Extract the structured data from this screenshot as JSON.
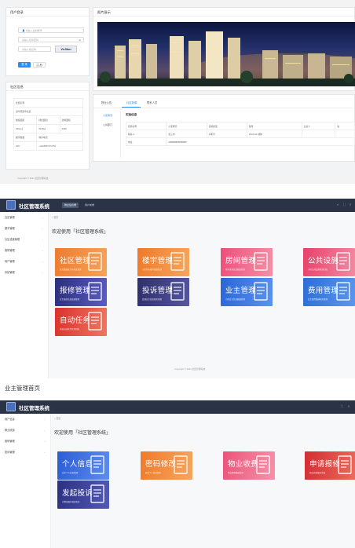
{
  "admin_login": {
    "user_card_title": "用户登录",
    "username_placeholder": "请输入您的账号",
    "password_placeholder": "请输入您的密码",
    "captcha_placeholder": "请输入验证码",
    "captcha_text": "Vn3bm",
    "login_label": "登 录",
    "reset_label": "注 册",
    "banner_title": "图片展示",
    "info_card_title": "社区信息",
    "info_rows": [
      [
        "社区名称",
        ""
      ],
      [
        "锦华苑锦华社区",
        ""
      ],
      [
        "楼栋面积",
        "绿化面积",
        "建筑面积"
      ],
      [
        "2310㎡",
        "5128㎡",
        "3600"
      ],
      [
        "楼宇数量",
        "联系电话"
      ],
      [
        "108",
        "+4415857074751"
      ]
    ],
    "tabs": [
      "物业公告",
      "社区新闻",
      "联系人员"
    ],
    "side_links": [
      "小区概况",
      "公共部门"
    ],
    "detail_title": "实验信息",
    "detail_rows": [
      [
        "实验名称",
        "小区概况",
        "实验类型",
        "院所",
        "负责人",
        "说"
      ],
      [
        "联系人",
        "张三丰",
        "手机号",
        "2024-02-9图8",
        "",
        ""
      ],
      [
        "地址",
        "408888888888888",
        "",
        "",
        "",
        ""
      ]
    ],
    "footer": "Copyright © 2021 社区管理系统"
  },
  "admin_home": {
    "app_title": "社区管理系统",
    "top_tabs": [
      "物业后台端",
      "用户前端"
    ],
    "sidebar": [
      "社区管理",
      "楼宇管理",
      "社区设施管理",
      "报修管理",
      "用户管理",
      "系统管理"
    ],
    "breadcrumb": "首页",
    "welcome": "欢迎使用「社区管理系统」",
    "tiles": [
      {
        "title": "社区管理",
        "sub": "社区数据统计分析及管理",
        "color1": "#ee7c2f",
        "color2": "#f6a35a"
      },
      {
        "title": "楼宇管理",
        "sub": "小区所有楼宇数据管理",
        "color1": "#ef7a2a",
        "color2": "#f7a65c"
      },
      {
        "title": "房间管理",
        "sub": "所有房间信息数据管理",
        "color1": "#ec4f7a",
        "color2": "#f690a6"
      },
      {
        "title": "公共设施",
        "sub": "小区公共设施管理功能",
        "color1": "#e9406b",
        "color2": "#f28aa2"
      },
      {
        "title": "报修管理",
        "sub": "业主报修信息处理管理",
        "color1": "#2b2e7a",
        "color2": "#5a5dc2"
      },
      {
        "title": "投诉管理",
        "sub": "处理业主投诉相关问题",
        "color1": "#2e2f6c",
        "color2": "#55569f"
      },
      {
        "title": "业主管理",
        "sub": "小区业主信息数据管理",
        "color1": "#2a66d6",
        "color2": "#5a93f0"
      },
      {
        "title": "费用管理",
        "sub": "业主费用缴纳相关管理",
        "color1": "#2d6ed6",
        "color2": "#5a96ee"
      },
      {
        "title": "自动任务",
        "sub": "系统自动执行任务列表",
        "color1": "#d9312d",
        "color2": "#ef7760"
      }
    ],
    "footer": "Copyright © 2021 社区管理系统"
  },
  "owner_section_title": "业主管理首页",
  "owner_home": {
    "app_title": "社区管理系统",
    "sidebar": [
      "用户信息",
      "物业收费",
      "报修管理",
      "投诉管理"
    ],
    "breadcrumb": "首页",
    "welcome": "欢迎使用「社区管理系统」",
    "tiles": [
      {
        "title": "个人信息",
        "sub": "业主个人信息管理",
        "color1": "#2d5dd4",
        "color2": "#5d8cf0"
      },
      {
        "title": "密码修改",
        "sub": "修改个人登录密码",
        "color1": "#ef7b2c",
        "color2": "#f7a55d"
      },
      {
        "title": "物业收费",
        "sub": "物业费用缴纳查询",
        "color1": "#ec5478",
        "color2": "#f592aa"
      },
      {
        "title": "申请报修",
        "sub": "提交房屋报修申请",
        "color1": "#d22e33",
        "color2": "#ee6b5c"
      },
      {
        "title": "发起投诉",
        "sub": "对物业服务发起投诉",
        "color1": "#2b3180",
        "color2": "#5359b8"
      }
    ]
  }
}
